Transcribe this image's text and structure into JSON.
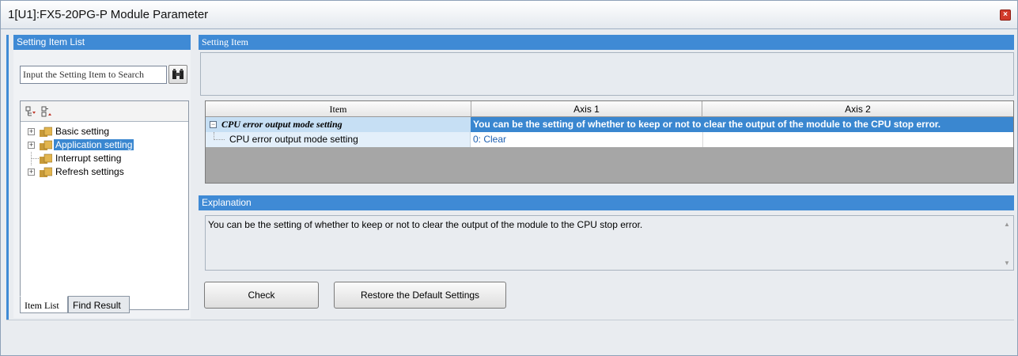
{
  "window": {
    "title": "1[U1]:FX5-20PG-P Module Parameter",
    "close_glyph": "×"
  },
  "left": {
    "header": "Setting Item List",
    "search_placeholder": "Input the Setting Item to Search",
    "tree": [
      {
        "label": "Basic setting",
        "expander": "+",
        "selected": false
      },
      {
        "label": "Application setting",
        "expander": "+",
        "selected": true
      },
      {
        "label": "Interrupt setting",
        "expander": "",
        "selected": false
      },
      {
        "label": "Refresh settings",
        "expander": "+",
        "selected": false
      }
    ],
    "tabs": {
      "item_list": "Item List",
      "find_result": "Find Result"
    }
  },
  "right": {
    "header": "Setting Item",
    "grid": {
      "columns": {
        "item": "Item",
        "axis1": "Axis 1",
        "axis2": "Axis 2"
      },
      "group_row": {
        "expander": "−",
        "item": "CPU error output mode setting",
        "description": "You can be the setting of whether to keep or not to clear the output of the module to the CPU stop error."
      },
      "param_row": {
        "item": "CPU error output mode setting",
        "axis1": "0: Clear",
        "axis2": ""
      }
    },
    "explanation_header": "Explanation",
    "explanation_text": "You can be the setting of whether to keep or not to clear the output of the module to the CPU stop error.",
    "buttons": {
      "check": "Check",
      "restore": "Restore the Default Settings"
    }
  },
  "colors": {
    "accent_blue": "#3f8ad5",
    "selected_row": "#3a87d0",
    "value_text": "#1d5fb0"
  }
}
